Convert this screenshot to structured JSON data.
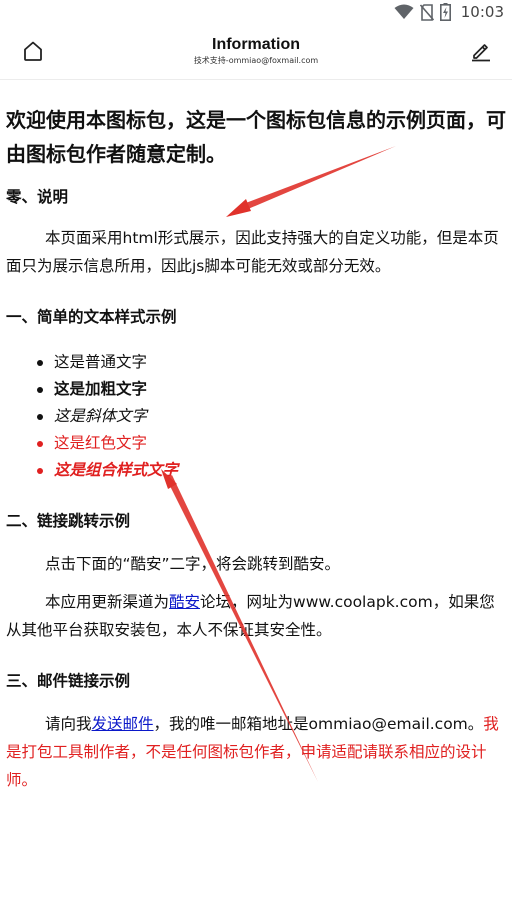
{
  "status_bar": {
    "time": "10:03",
    "icons": [
      "wifi-icon",
      "no-sim-icon",
      "battery-charging-icon"
    ]
  },
  "app_bar": {
    "title": "Information",
    "subtitle": "技术支持-ommiao@foxmail.com",
    "left_icon": "home-icon",
    "right_icon": "edit-pencil-icon"
  },
  "page": {
    "heading": "欢迎使用本图标包，这是一个图标包信息的示例页面，可由图标包作者随意定制。",
    "section_zero": {
      "title": "零、说明",
      "text": "本页面采用html形式展示，因此支持强大的自定义功能，但是本页面只为展示信息所用，因此js脚本可能无效或部分无效。"
    },
    "section_one": {
      "title": "一、简单的文本样式示例",
      "items": [
        "这是普通文字",
        "这是加粗文字",
        "这是斜体文字",
        "这是红色文字",
        "这是组合样式文字"
      ]
    },
    "section_two": {
      "title": "二、链接跳转示例",
      "p1": "点击下面的“酷安”二字，将会跳转到酷安。",
      "p2_before": "本应用更新渠道为",
      "p2_link": "酷安",
      "p2_after": "论坛，网址为www.coolapk.com，如果您从其他平台获取安装包，本人不保证其安全性。"
    },
    "section_three": {
      "title": "三、邮件链接示例",
      "p_before": "请向我",
      "p_link": "发送邮件",
      "p_middle": "，我的唯一邮箱地址是ommiao@email.com。",
      "p_red": "我是打包工具制作者，不是任何图标包作者，申请适配请联系相应的设计师。"
    }
  },
  "colors": {
    "accent_red": "#e02020",
    "link_blue": "#0b18c9",
    "arrow_red": "#e0322b"
  }
}
